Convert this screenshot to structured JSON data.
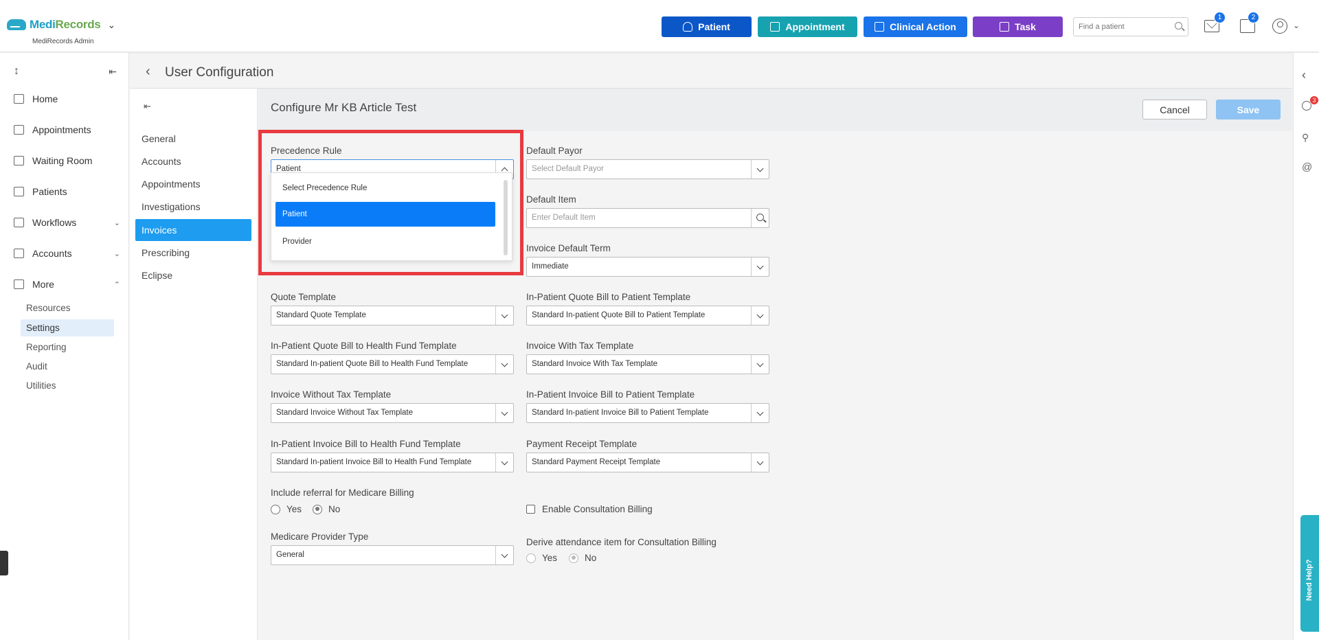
{
  "app": {
    "logo_text_a": "Medi",
    "logo_text_b": "Records",
    "subtitle": "MediRecords Admin"
  },
  "header": {
    "buttons": [
      {
        "label": "Patient",
        "color": "#0b57c8",
        "icon": "add-person-icon"
      },
      {
        "label": "Appointment",
        "color": "#17a2b0",
        "icon": "calendar-icon"
      },
      {
        "label": "Clinical Action",
        "color": "#1a73e8",
        "icon": "medical-briefcase-icon"
      },
      {
        "label": "Task",
        "color": "#7b3fc7",
        "icon": "clipboard-icon"
      }
    ],
    "search_placeholder": "Find a patient",
    "mail_badge": "1",
    "tasks_badge": "2"
  },
  "sidebar": {
    "items": [
      {
        "label": "Home",
        "icon": "home-icon"
      },
      {
        "label": "Appointments",
        "icon": "calendar-icon"
      },
      {
        "label": "Waiting Room",
        "icon": "waiting-room-icon"
      },
      {
        "label": "Patients",
        "icon": "patients-icon"
      },
      {
        "label": "Workflows",
        "icon": "workflows-icon"
      },
      {
        "label": "Accounts",
        "icon": "folder-icon"
      },
      {
        "label": "More",
        "icon": "more-icon"
      }
    ],
    "more_children": [
      "Resources",
      "Settings",
      "Reporting",
      "Audit",
      "Utilities"
    ],
    "active_child": "Settings"
  },
  "page": {
    "title": "User Configuration",
    "configure_title": "Configure Mr KB Article Test"
  },
  "subnav": {
    "items": [
      "General",
      "Accounts",
      "Appointments",
      "Investigations",
      "Invoices",
      "Prescribing",
      "Eclipse"
    ],
    "active": "Invoices"
  },
  "actions": {
    "cancel": "Cancel",
    "save": "Save"
  },
  "form": {
    "precedence_rule": {
      "label": "Precedence Rule",
      "value": "Patient"
    },
    "precedence_options": [
      "Select Precedence Rule",
      "Patient",
      "Provider"
    ],
    "default_payor": {
      "label": "Default Payor",
      "placeholder": "Select Default Payor"
    },
    "default_item": {
      "label": "Default Item",
      "placeholder": "Enter Default Item"
    },
    "invoice_default_term": {
      "label": "Invoice Default Term",
      "value": "Immediate"
    },
    "quote_template": {
      "label": "Quote Template",
      "value": "Standard Quote Template"
    },
    "inpatient_quote_patient": {
      "label": "In-Patient Quote Bill to Patient Template",
      "value": "Standard In-patient Quote Bill to Patient Template"
    },
    "inpatient_quote_fund": {
      "label": "In-Patient Quote Bill to Health Fund Template",
      "value": "Standard In-patient Quote Bill to Health Fund Template"
    },
    "invoice_with_tax": {
      "label": "Invoice With Tax Template",
      "value": "Standard Invoice With Tax Template"
    },
    "invoice_without_tax": {
      "label": "Invoice Without Tax Template",
      "value": "Standard Invoice Without Tax Template"
    },
    "inpatient_invoice_patient": {
      "label": "In-Patient Invoice Bill to Patient Template",
      "value": "Standard In-patient Invoice Bill to Patient Template"
    },
    "inpatient_invoice_fund": {
      "label": "In-Patient Invoice Bill to Health Fund Template",
      "value": "Standard In-patient Invoice Bill to Health Fund Template"
    },
    "payment_receipt": {
      "label": "Payment Receipt Template",
      "value": "Standard Payment Receipt Template"
    },
    "include_referral": {
      "label": "Include referral for Medicare Billing",
      "yes": "Yes",
      "no": "No",
      "selected": "No"
    },
    "enable_consultation": {
      "label": "Enable Consultation Billing",
      "checked": false
    },
    "medicare_provider_type": {
      "label": "Medicare Provider Type",
      "value": "General"
    },
    "derive_attendance": {
      "label": "Derive attendance item for Consultation Billing",
      "yes": "Yes",
      "no": "No",
      "selected": "No"
    }
  },
  "right_rail": {
    "notifications_badge": "3",
    "help_label": "Need Help?"
  },
  "highlight_color": "#e83a3f"
}
